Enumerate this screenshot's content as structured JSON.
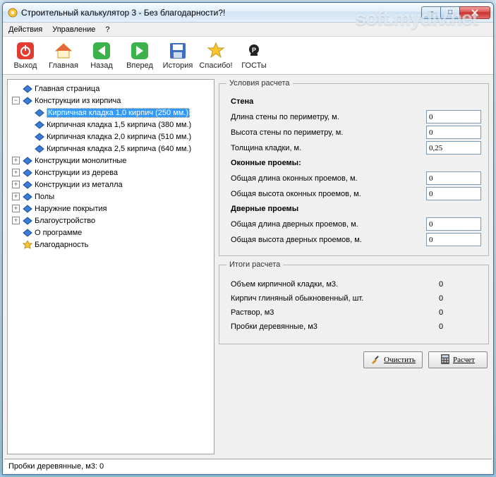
{
  "window": {
    "title": "Строительный калькулятор 3 - Без благодарности?!"
  },
  "menubar": {
    "actions": "Действия",
    "manage": "Управление",
    "help": "?"
  },
  "toolbar": {
    "exit": "Выход",
    "home": "Главная",
    "back": "Назад",
    "forward": "Вперед",
    "history": "История",
    "thanks": "Спасибо!",
    "gosty": "ГОСТы"
  },
  "tree": {
    "main_page": "Главная страница",
    "brick": "Конструкции из кирпича",
    "brick_children": [
      "Кирпичная кладка 1,0 кирпич (250 мм.)",
      "Кирпичная кладка 1,5 кирпича (380 мм.)",
      "Кирпичная кладка 2,0 кирпича  (510 мм.)",
      "Кирпичная кладка 2,5 кирпича  (640 мм.)"
    ],
    "monolith": "Конструкции монолитные",
    "wood": "Конструкции из дерева",
    "metal": "Конструкции из металла",
    "floors": "Полы",
    "outer": "Наружние покрытия",
    "landscape": "Благоустройство",
    "about": "О программе",
    "gratitude": "Благодарность"
  },
  "calc": {
    "conditions_legend": "Условия расчета",
    "wall_title": "Стена",
    "wall_perimeter_label": "Длина стены по периметру, м.",
    "wall_perimeter_value": "0",
    "wall_height_label": "Высота стены по периметру, м.",
    "wall_height_value": "0",
    "thickness_label": "Толщина кладки, м.",
    "thickness_value": "0,25",
    "windows_title": "Оконные проемы:",
    "windows_len_label": "Общая длина оконных проемов, м.",
    "windows_len_value": "0",
    "windows_h_label": "Общая высота оконных проемов, м.",
    "windows_h_value": "0",
    "doors_title": "Дверные проемы",
    "doors_len_label": "Общая длина дверных проемов, м.",
    "doors_len_value": "0",
    "doors_h_label": "Общая высота дверных проемов, м.",
    "doors_h_value": "0"
  },
  "results": {
    "legend": "Итоги расчета",
    "volume_label": "Объем кирпичной кладки, м3.",
    "volume_value": "0",
    "bricks_label": "Кирпич глиняный обыкновенный, шт.",
    "bricks_value": "0",
    "mortar_label": "Раствор, м3",
    "mortar_value": "0",
    "plugs_label": "Пробки деревянные, м3",
    "plugs_value": "0"
  },
  "buttons": {
    "clear": "Очистить",
    "calc": "Расчет"
  },
  "statusbar": {
    "text": "Пробки деревянные, м3: 0"
  },
  "watermark": "soft.mydiv.net"
}
